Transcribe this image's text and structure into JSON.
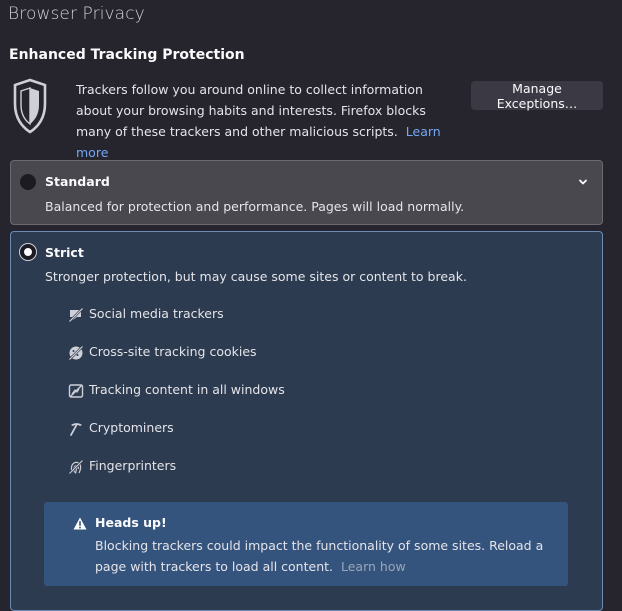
{
  "page": {
    "title": "Browser Privacy"
  },
  "etp": {
    "heading": "Enhanced Tracking Protection",
    "intro": "Trackers follow you around online to collect information about your browsing habits and interests. Firefox blocks many of these trackers and other malicious scripts.",
    "learn_more": "Learn more",
    "manage_button": "Manage Exceptions…"
  },
  "options": {
    "standard": {
      "label": "Standard",
      "description": "Balanced for protection and performance. Pages will load normally.",
      "selected": false,
      "expanded": false
    },
    "strict": {
      "label": "Strict",
      "description": "Stronger protection, but may cause some sites or content to break.",
      "selected": true,
      "trackers": [
        {
          "label": "Social media trackers",
          "icon": "social-tracker-icon"
        },
        {
          "label": "Cross-site tracking cookies",
          "icon": "cookie-icon"
        },
        {
          "label": "Tracking content in all windows",
          "icon": "tracking-content-icon"
        },
        {
          "label": "Cryptominers",
          "icon": "cryptominer-icon"
        },
        {
          "label": "Fingerprinters",
          "icon": "fingerprint-icon"
        }
      ],
      "heads_up": {
        "title": "Heads up!",
        "body": "Blocking trackers could impact the functionality of some sites. Reload a page with trackers to load all content.",
        "learn_how": "Learn how"
      }
    }
  },
  "colors": {
    "background": "#26252e",
    "accent_link": "#73a7f3",
    "selected_card": "#2c3b4f",
    "notice": "#35547d"
  }
}
